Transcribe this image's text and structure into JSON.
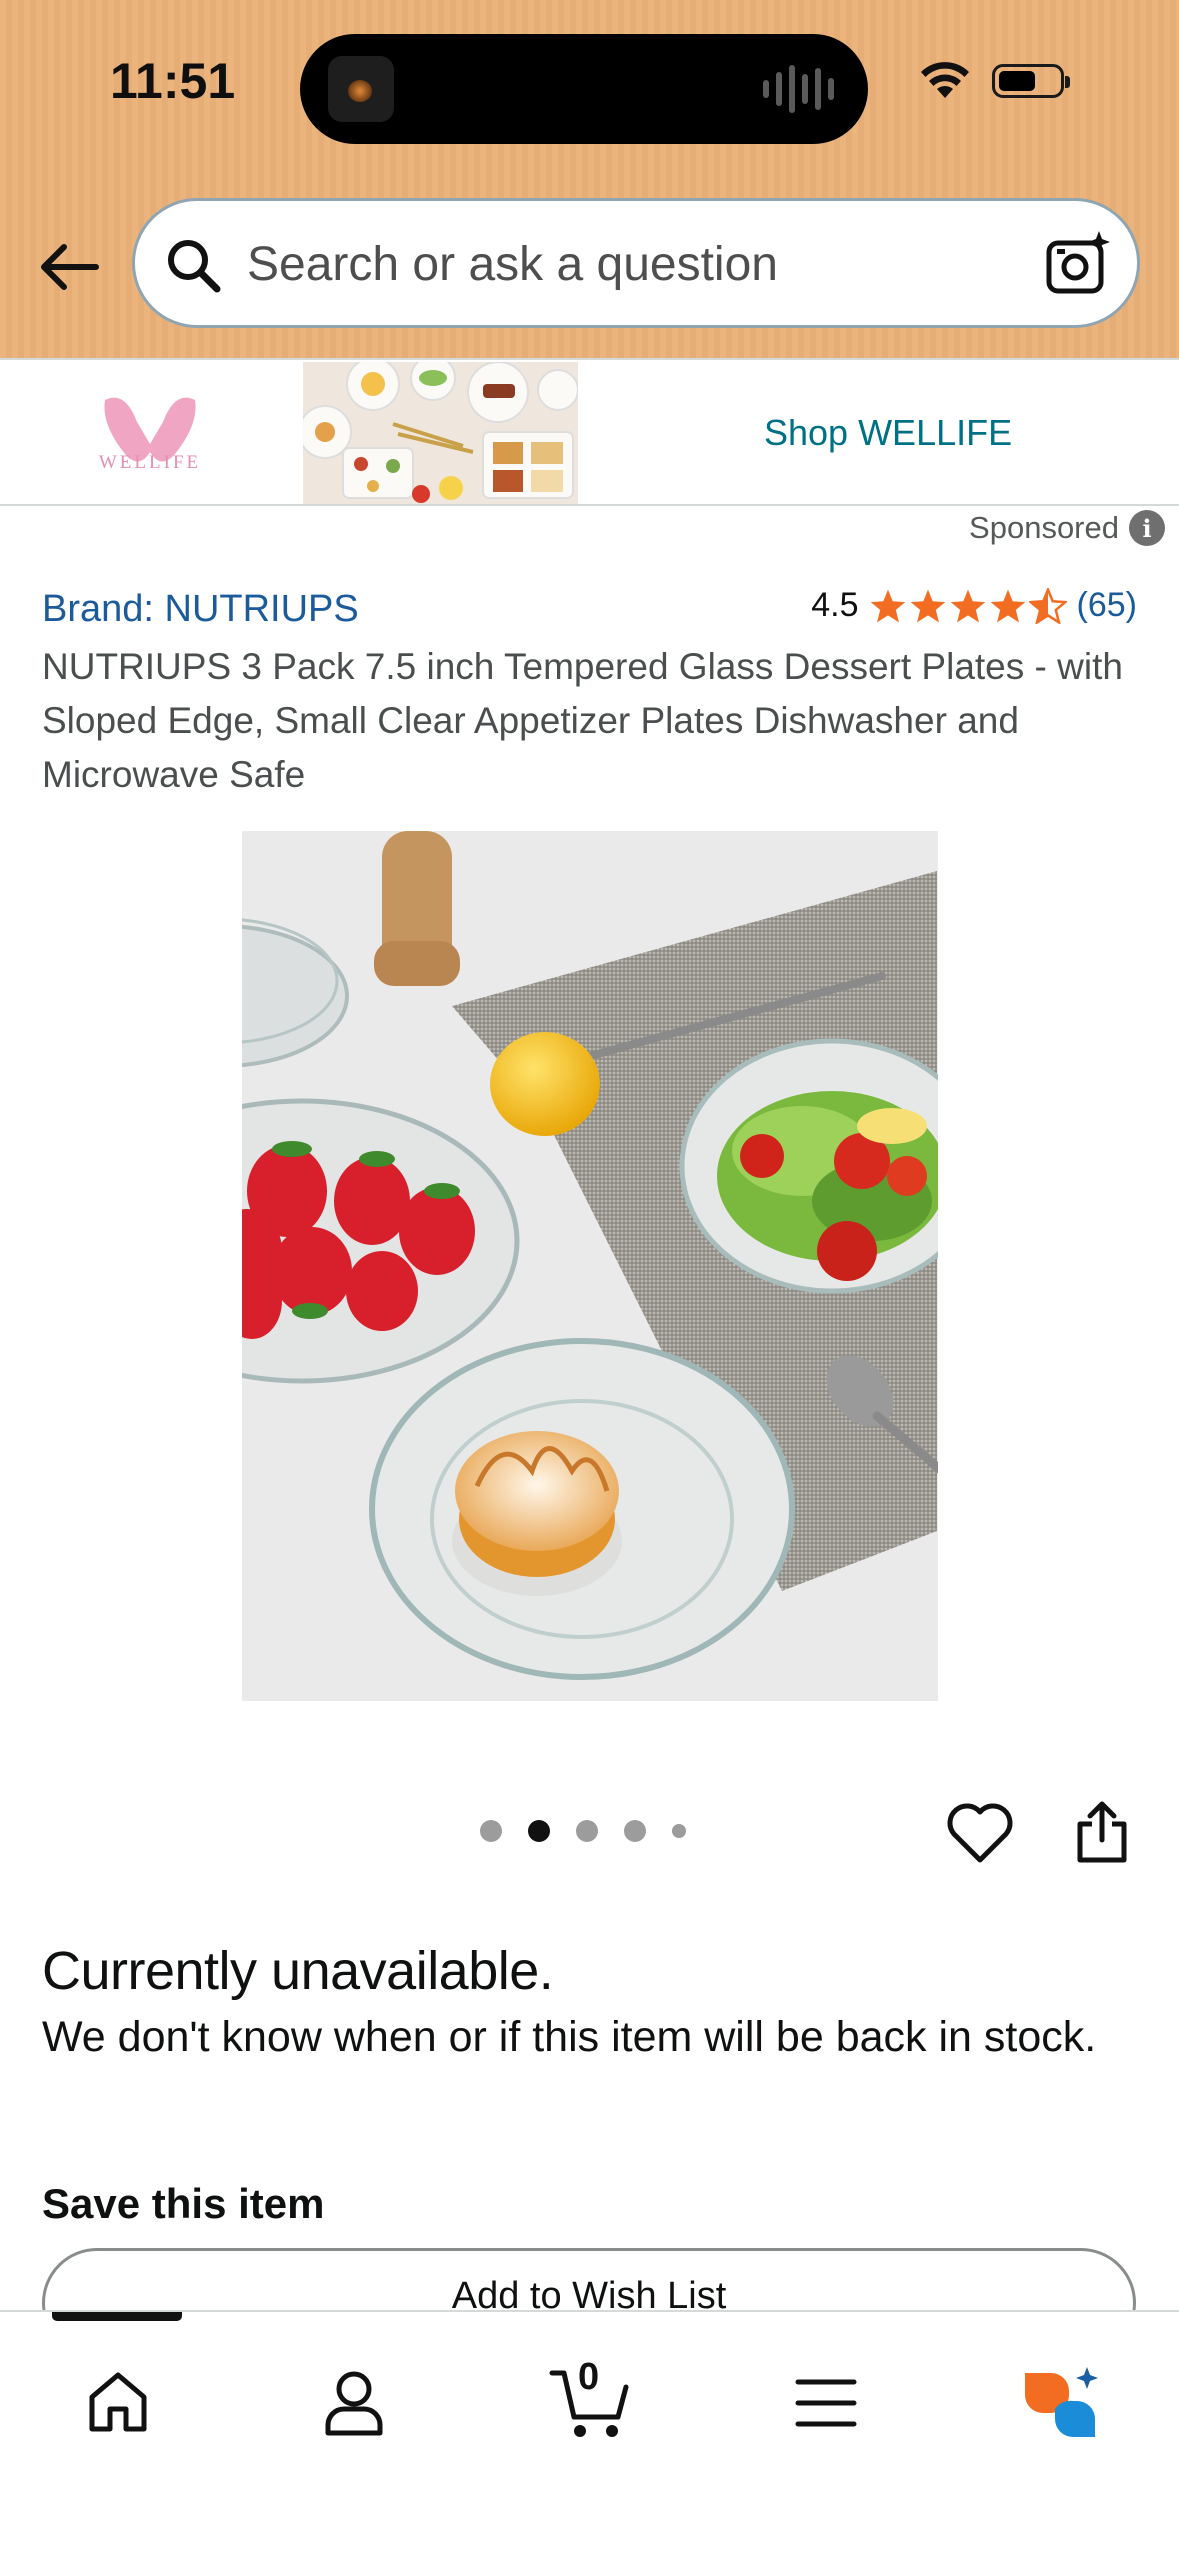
{
  "status_bar": {
    "time": "11:51"
  },
  "search": {
    "placeholder": "Search or ask a question"
  },
  "sponsored_banner": {
    "logo_text": "WELLIFE",
    "link": "Shop WELLIFE",
    "sponsored_label": "Sponsored"
  },
  "product": {
    "brand": "Brand: NUTRIUPS",
    "rating": "4.5",
    "rating_stars": 4.5,
    "rating_count": "(65)",
    "title": "NUTRIUPS 3 Pack 7.5 inch Tempered Glass Dessert Plates - with Sloped Edge, Small Clear Appetizer Plates Dishwasher and Microwave Safe",
    "image_count": 5,
    "current_image": 2
  },
  "availability": {
    "title": "Currently unavailable.",
    "message": "We don't know when or if this item will be back in stock."
  },
  "save_section": {
    "title": "Save this item",
    "button": "Add to Wish List"
  },
  "tabbar": {
    "items": [
      "home-icon",
      "account-icon",
      "cart-icon",
      "menu-icon",
      "rufus-icon"
    ],
    "cart_count": "0"
  },
  "colors": {
    "header": "#ebb47d",
    "link": "#1b5a9b",
    "star": "#f26c21",
    "teal": "#007185"
  }
}
